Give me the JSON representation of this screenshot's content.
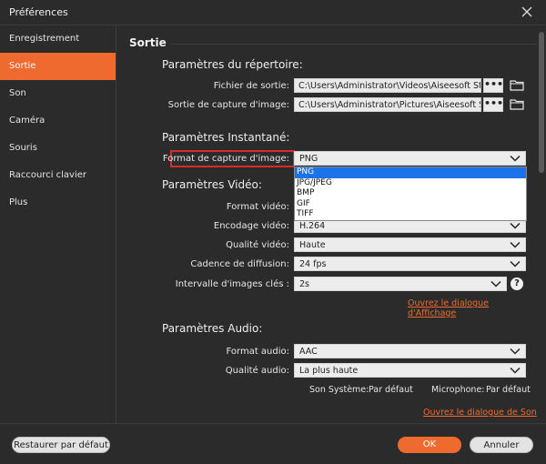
{
  "window": {
    "title": "Préférences"
  },
  "sidebar": {
    "items": [
      {
        "label": "Enregistrement"
      },
      {
        "label": "Sortie"
      },
      {
        "label": "Son"
      },
      {
        "label": "Caméra"
      },
      {
        "label": "Souris"
      },
      {
        "label": "Raccourci clavier"
      },
      {
        "label": "Plus"
      }
    ],
    "active": "Sortie"
  },
  "section": {
    "title": "Sortie"
  },
  "directory": {
    "heading": "Paramètres du répertoire:",
    "output_label": "Fichier de sortie:",
    "output_value": "C:\\Users\\Administrator\\Videos\\Aiseesoft Stuc",
    "capture_label": "Sortie de capture d'image:",
    "capture_value": "C:\\Users\\Administrator\\Pictures\\Aiseesoft Stu",
    "browse_label": "•••"
  },
  "snapshot": {
    "heading": "Paramètres Instantané:",
    "format_label": "Format de capture d'image:",
    "format_value": "PNG",
    "options": [
      "PNG",
      "JPG/JPEG",
      "BMP",
      "GIF",
      "TIFF"
    ]
  },
  "video": {
    "heading": "Paramètres Vidéo:",
    "format_label": "Format vidéo:",
    "encoder_label": "Encodage vidéo:",
    "encoder_value": "H.264",
    "quality_label": "Qualité vidéo:",
    "quality_value": "Haute",
    "fps_label": "Cadence de diffusion:",
    "fps_value": "24 fps",
    "keyframe_label": "Intervalle d'images clés :",
    "keyframe_value": "2s",
    "help_label": "?",
    "display_link": "Ouvrez le dialogue d'Affichage"
  },
  "audio": {
    "heading": "Paramètres Audio:",
    "format_label": "Format audio:",
    "format_value": "AAC",
    "quality_label": "Qualité audio:",
    "quality_value": "La plus haute",
    "system_label": "Son Système:",
    "system_value": "Par défaut",
    "mic_label": "Microphone:",
    "mic_value": "Par défaut",
    "sound_link": "Ouvrez le dialogue de Son"
  },
  "footer": {
    "restore_label": "Restaurer par défaut",
    "ok_label": "OK",
    "cancel_label": "Annuler"
  },
  "colors": {
    "accent": "#ee6a2f",
    "highlight": "#d82b2b",
    "background": "#2b2b2b"
  }
}
